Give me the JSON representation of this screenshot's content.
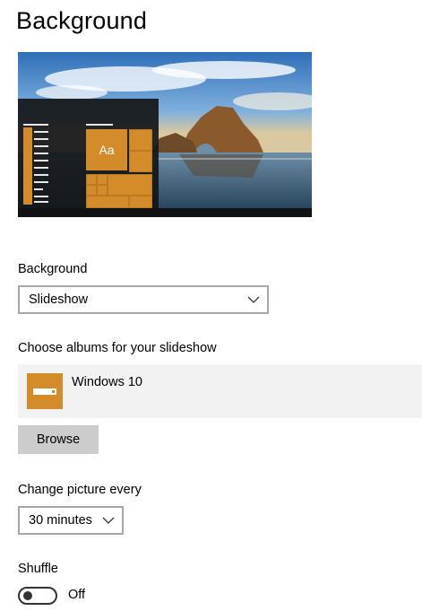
{
  "page": {
    "title": "Background"
  },
  "preview": {
    "sample_text": "Aa",
    "accent": "#d48b2a"
  },
  "background": {
    "label": "Background",
    "selected": "Slideshow"
  },
  "albums": {
    "label": "Choose albums for your slideshow",
    "items": [
      {
        "name": "Windows 10",
        "icon": "folder-icon"
      }
    ],
    "browse_label": "Browse"
  },
  "interval": {
    "label": "Change picture every",
    "selected": "30 minutes"
  },
  "shuffle": {
    "label": "Shuffle",
    "state_text": "Off",
    "on": false
  }
}
